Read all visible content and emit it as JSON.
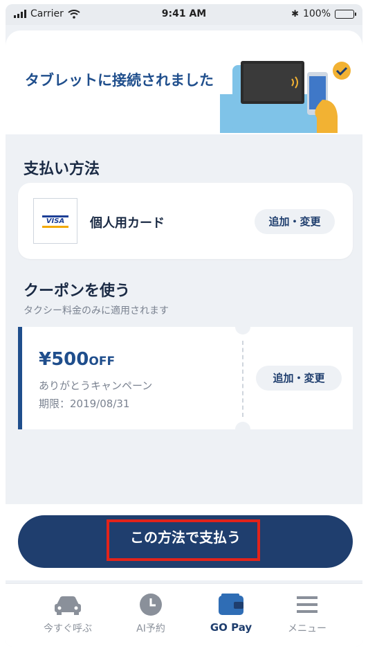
{
  "status_bar": {
    "carrier": "Carrier",
    "time": "9:41 AM",
    "battery": "100%"
  },
  "banner": {
    "title": "タブレットに接続されました"
  },
  "payment": {
    "section_title": "支払い方法",
    "card_brand": "VISA",
    "card_name": "個人用カード",
    "change_label": "追加・変更"
  },
  "coupon": {
    "section_title": "クーポンを使う",
    "section_note": "タクシー料金のみに適用されます",
    "amount": "¥500",
    "amount_suffix": "OFF",
    "campaign": "ありがとうキャンペーン",
    "expiry": "期限：2019/08/31",
    "change_label": "追加・変更"
  },
  "pay_button": {
    "label": "この方法で支払う"
  },
  "tabbar": {
    "items": [
      {
        "label": "今すぐ呼ぶ",
        "icon": "car-icon"
      },
      {
        "label": "AI予約",
        "icon": "clock-icon"
      },
      {
        "label": "GO Pay",
        "icon": "wallet-icon"
      },
      {
        "label": "メニュー",
        "icon": "menu-icon"
      }
    ],
    "active_index": 2
  },
  "colors": {
    "accent": "#1f4e8c",
    "button": "#1f3e6e",
    "highlight": "#e2231a"
  }
}
